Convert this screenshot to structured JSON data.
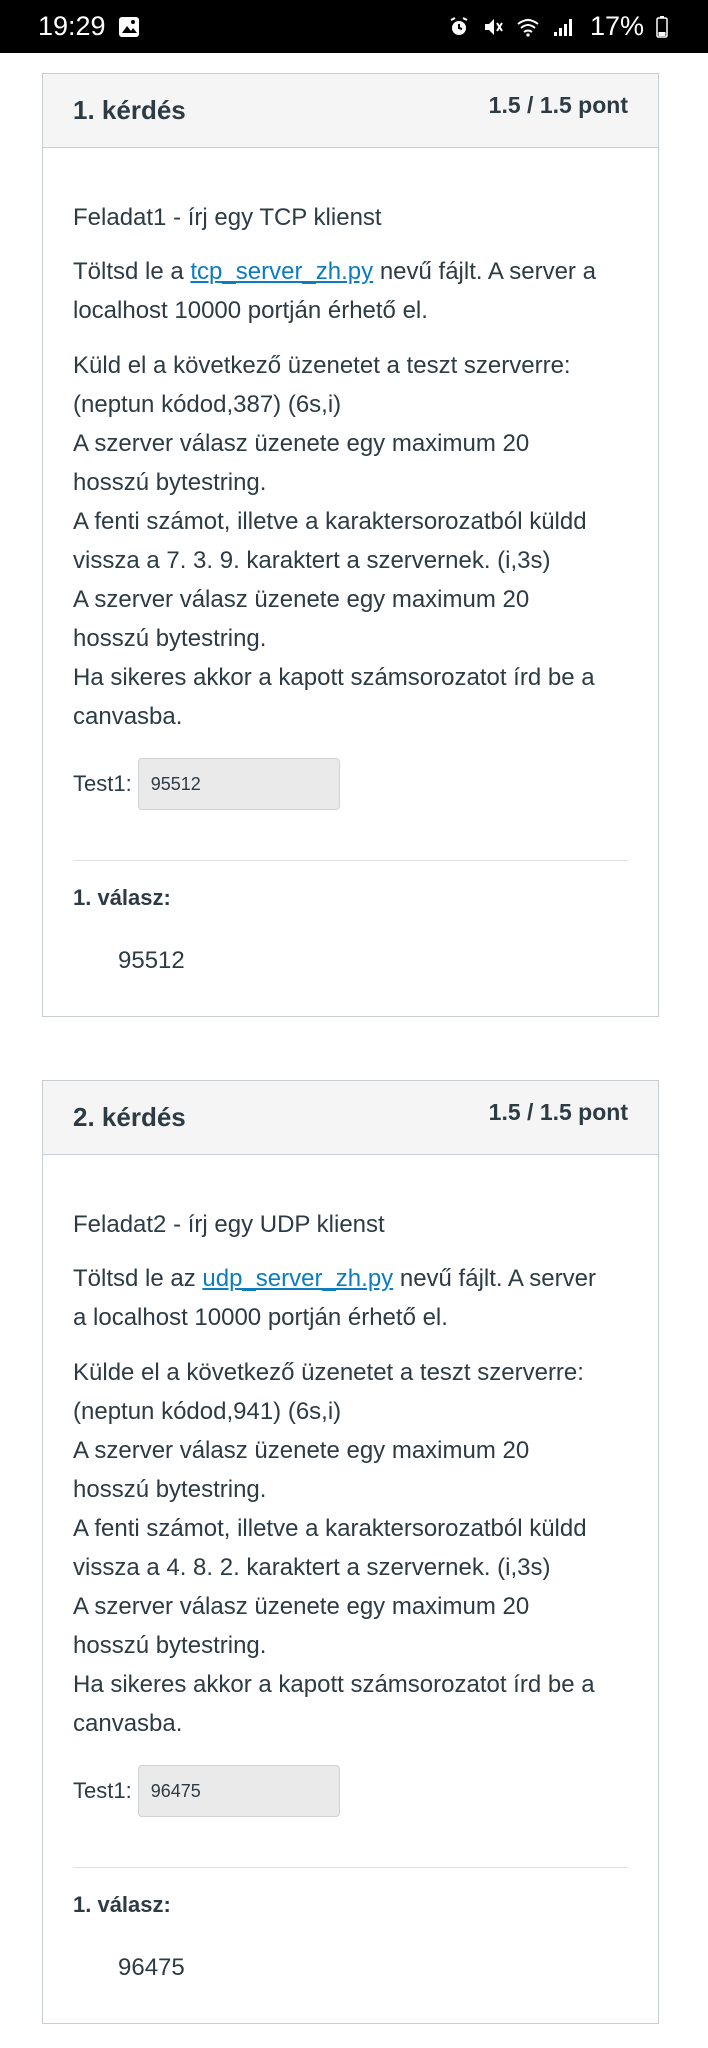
{
  "status_bar": {
    "time": "19:29",
    "battery": "17%"
  },
  "questions": [
    {
      "title": "1. kérdés",
      "score": "1.5 / 1.5 pont",
      "task_title": "Feladat1 - írj egy TCP klienst",
      "download": {
        "prefix": "Töltsd le a ",
        "link": "tcp_server_zh.py",
        "line1_suffix": " nevű fájlt. A server a",
        "line2": "localhost 10000 portján érhető el."
      },
      "instructions": [
        "Küld el a következő üzenetet a teszt szerverre:",
        "(neptun kódod,387) (6s,i)",
        "A szerver válasz üzenete egy maximum 20",
        "hosszú bytestring.",
        "A fenti számot, illetve a karaktersorozatból küldd",
        "vissza a 7. 3. 9. karaktert a szervernek. (i,3s)",
        "A szerver válasz üzenete egy maximum 20",
        "hosszú bytestring.",
        "Ha sikeres akkor a kapott számsorozatot írd be a",
        "canvasba."
      ],
      "test_label": "Test1:",
      "test_value": "95512",
      "answer_label": "1. válasz:",
      "answer_value": "95512"
    },
    {
      "title": "2. kérdés",
      "score": "1.5 / 1.5 pont",
      "task_title": "Feladat2 - írj egy UDP klienst",
      "download": {
        "prefix": "Töltsd le az ",
        "link": "udp_server_zh.py",
        "line1_suffix": " nevű fájlt. A server",
        "line2": "a localhost 10000 portján érhető el."
      },
      "instructions": [
        "Külde el a következő üzenetet a teszt szerverre:",
        "(neptun kódod,941) (6s,i)",
        "A szerver válasz üzenete egy maximum 20",
        "hosszú bytestring.",
        "A fenti számot, illetve a karaktersorozatból küldd",
        "vissza a 4. 8. 2. karaktert a szervernek. (i,3s)",
        "A szerver válasz üzenete egy maximum 20",
        "hosszú bytestring.",
        "Ha sikeres akkor a kapott számsorozatot írd be a",
        "canvasba."
      ],
      "test_label": "Test1:",
      "test_value": "96475",
      "answer_label": "1. válasz:",
      "answer_value": "96475"
    }
  ]
}
